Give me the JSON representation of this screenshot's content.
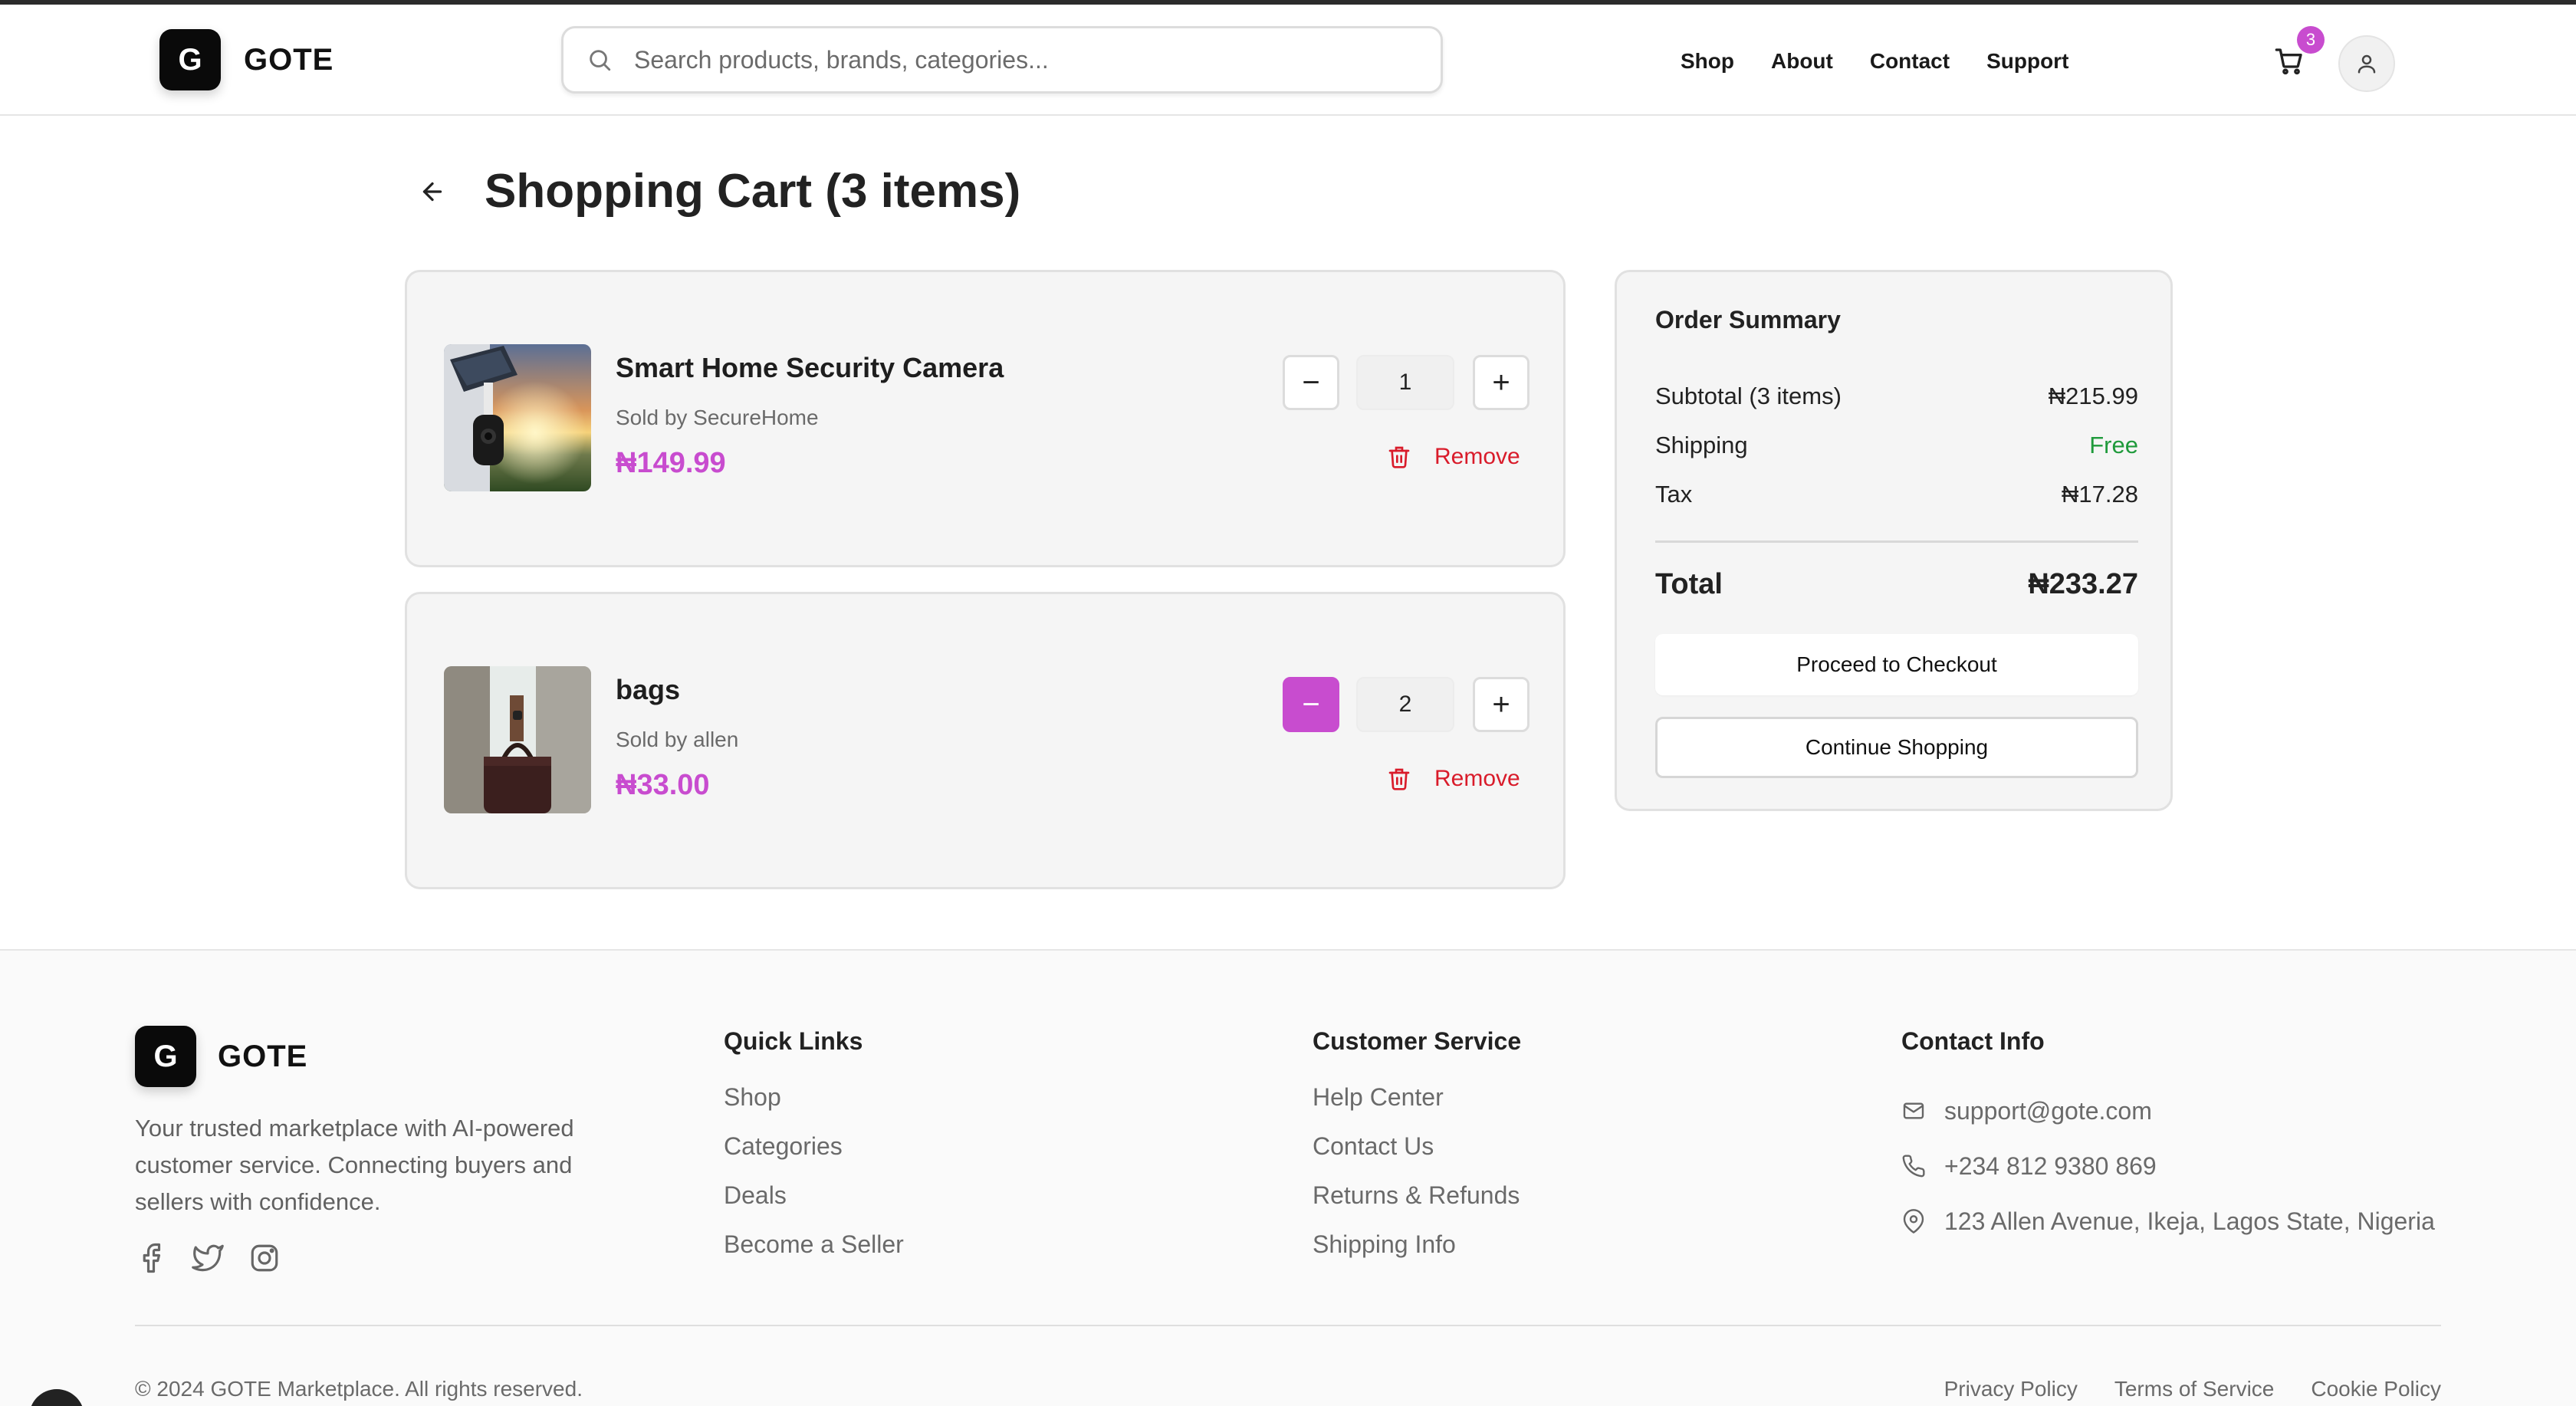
{
  "brand": {
    "logo_letter": "G",
    "name": "GOTE"
  },
  "search": {
    "placeholder": "Search products, brands, categories..."
  },
  "nav": {
    "shop": "Shop",
    "about": "About",
    "contact": "Contact",
    "support": "Support"
  },
  "cart": {
    "badge": "3",
    "icon": "shopping-cart-icon"
  },
  "user": {
    "icon": "user-icon"
  },
  "page": {
    "title": "Shopping Cart (3 items)"
  },
  "items": [
    {
      "name": "Smart Home Security Camera",
      "seller": "Sold by SecureHome",
      "price": "₦149.99",
      "quantity": "1",
      "remove_label": "Remove",
      "minus": "−",
      "plus": "+"
    },
    {
      "name": "bags",
      "seller": "Sold by allen",
      "price": "₦33.00",
      "quantity": "2",
      "remove_label": "Remove",
      "minus": "−",
      "plus": "+"
    }
  ],
  "summary": {
    "title": "Order Summary",
    "subtotal_label": "Subtotal (3 items)",
    "subtotal_value": "₦215.99",
    "shipping_label": "Shipping",
    "shipping_value": "Free",
    "tax_label": "Tax",
    "tax_value": "₦17.28",
    "total_label": "Total",
    "total_value": "₦233.27",
    "checkout_label": "Proceed to Checkout",
    "continue_label": "Continue Shopping"
  },
  "footer": {
    "logo_letter": "G",
    "name": "GOTE",
    "description": "Your trusted marketplace with AI-powered customer service. Connecting buyers and sellers with confidence.",
    "quick_links": {
      "title": "Quick Links",
      "links": [
        "Shop",
        "Categories",
        "Deals",
        "Become a Seller"
      ]
    },
    "customer_service": {
      "title": "Customer Service",
      "links": [
        "Help Center",
        "Contact Us",
        "Returns & Refunds",
        "Shipping Info"
      ]
    },
    "contact": {
      "title": "Contact Info",
      "email": "support@gote.com",
      "phone": "+234 812 9380 869",
      "address": "123 Allen Avenue, Ikeja, Lagos State, Nigeria"
    },
    "copyright": "© 2024 GOTE Marketplace. All rights reserved.",
    "legal": [
      "Privacy Policy",
      "Terms of Service",
      "Cookie Policy"
    ]
  },
  "colors": {
    "accent": "#c84ccf",
    "danger": "#d91b2a",
    "success": "#1f9a3b"
  }
}
